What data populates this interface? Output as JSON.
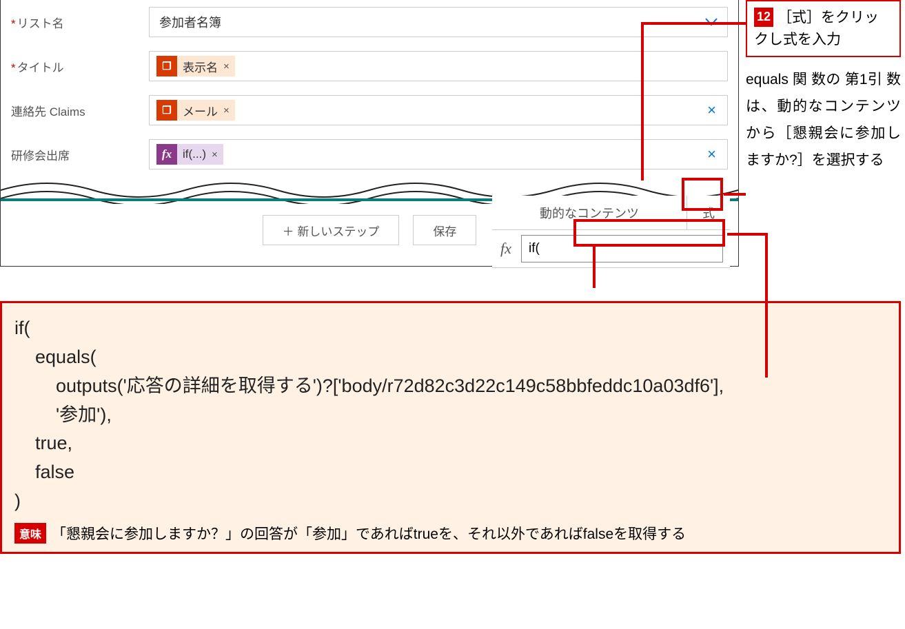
{
  "form": {
    "rows": [
      {
        "label": "リスト名",
        "required": true,
        "type": "dropdown",
        "value": "参加者名簿"
      },
      {
        "label": "タイトル",
        "required": true,
        "type": "token",
        "token_icon": "orange",
        "token_glyph": "❐",
        "token_text": "表示名"
      },
      {
        "label": "連絡先 Claims",
        "required": false,
        "type": "token-clear",
        "token_icon": "orange",
        "token_glyph": "❐",
        "token_text": "メール"
      },
      {
        "label": "研修会出席",
        "required": false,
        "type": "token-clear",
        "token_icon": "purple",
        "token_glyph": "fx",
        "token_text": "if(...)"
      }
    ]
  },
  "buttons": {
    "new_step": "＋ 新しいステップ",
    "save": "保存"
  },
  "fx_panel": {
    "tab_dynamic": "動的なコンテンツ",
    "tab_expr": "式",
    "symbol": "fx",
    "input_value": "if("
  },
  "callout_12": {
    "step": "12",
    "text": "［式］をクリックし式を入力"
  },
  "sidebar_note": "equals 関 数の 第1引 数は、動的なコンテンツから［懇親会に参加しますか?］を選択する",
  "code": "if(\n    equals(\n        outputs('応答の詳細を取得する')?['body/r72d82c3d22c149c58bbfeddc10a03df6'],\n        '参加'),\n    true,\n    false\n)",
  "meaning": {
    "badge": "意味",
    "text": "「懇親会に参加しますか？」の回答が「参加」であればtrueを、それ以外であればfalseを取得する"
  }
}
